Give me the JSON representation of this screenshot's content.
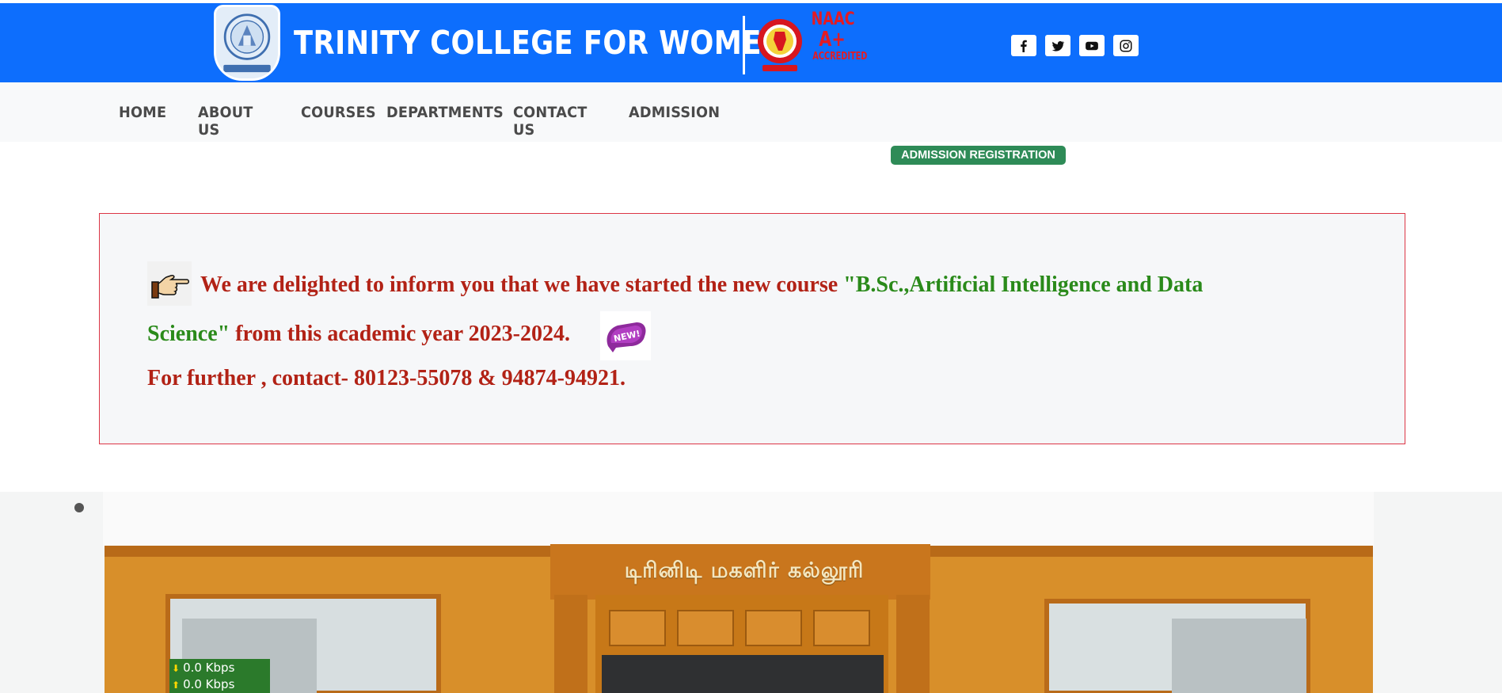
{
  "header": {
    "college_name": "TRINITY COLLEGE FOR WOMEN",
    "naac_line1": "NAAC",
    "naac_line2": "A+",
    "naac_line3": "ACCREDITED",
    "logo_caption": "TRINITY COLLEGE FOR WOMEN",
    "social_icons": [
      "facebook-icon",
      "twitter-icon",
      "youtube-icon",
      "instagram-icon"
    ],
    "colors": {
      "bar": "#0d6efd",
      "naac": "#e31b23"
    }
  },
  "nav": {
    "items": [
      "HOME",
      "ABOUT US",
      "COURSES",
      "DEPARTMENTS",
      "CONTACT US",
      "ADMISSION"
    ]
  },
  "admission_button": {
    "label": "ADMISSION REGISTRATION",
    "color": "#2e8b57"
  },
  "notice": {
    "line1_text": "We are delighted to inform you that we have started the new course ",
    "course_part1": "\"B.Sc.,Artificial Intelligence and Data",
    "course_part2": "Science\"",
    "line2_text": " from this academic year 2023-2024.",
    "line3_text": "For further , contact- 80123-55078 & 94874-94921.",
    "badge_text": "NEW!",
    "colors": {
      "text": "#b22216",
      "course": "#2a8a1a",
      "border": "#dc3545"
    }
  },
  "photo": {
    "sign_text": "டிரினிடி மகளிர் கல்லூரி"
  },
  "speed_meter": {
    "download": "0.0 Kbps",
    "upload": "0.0 Kbps"
  }
}
